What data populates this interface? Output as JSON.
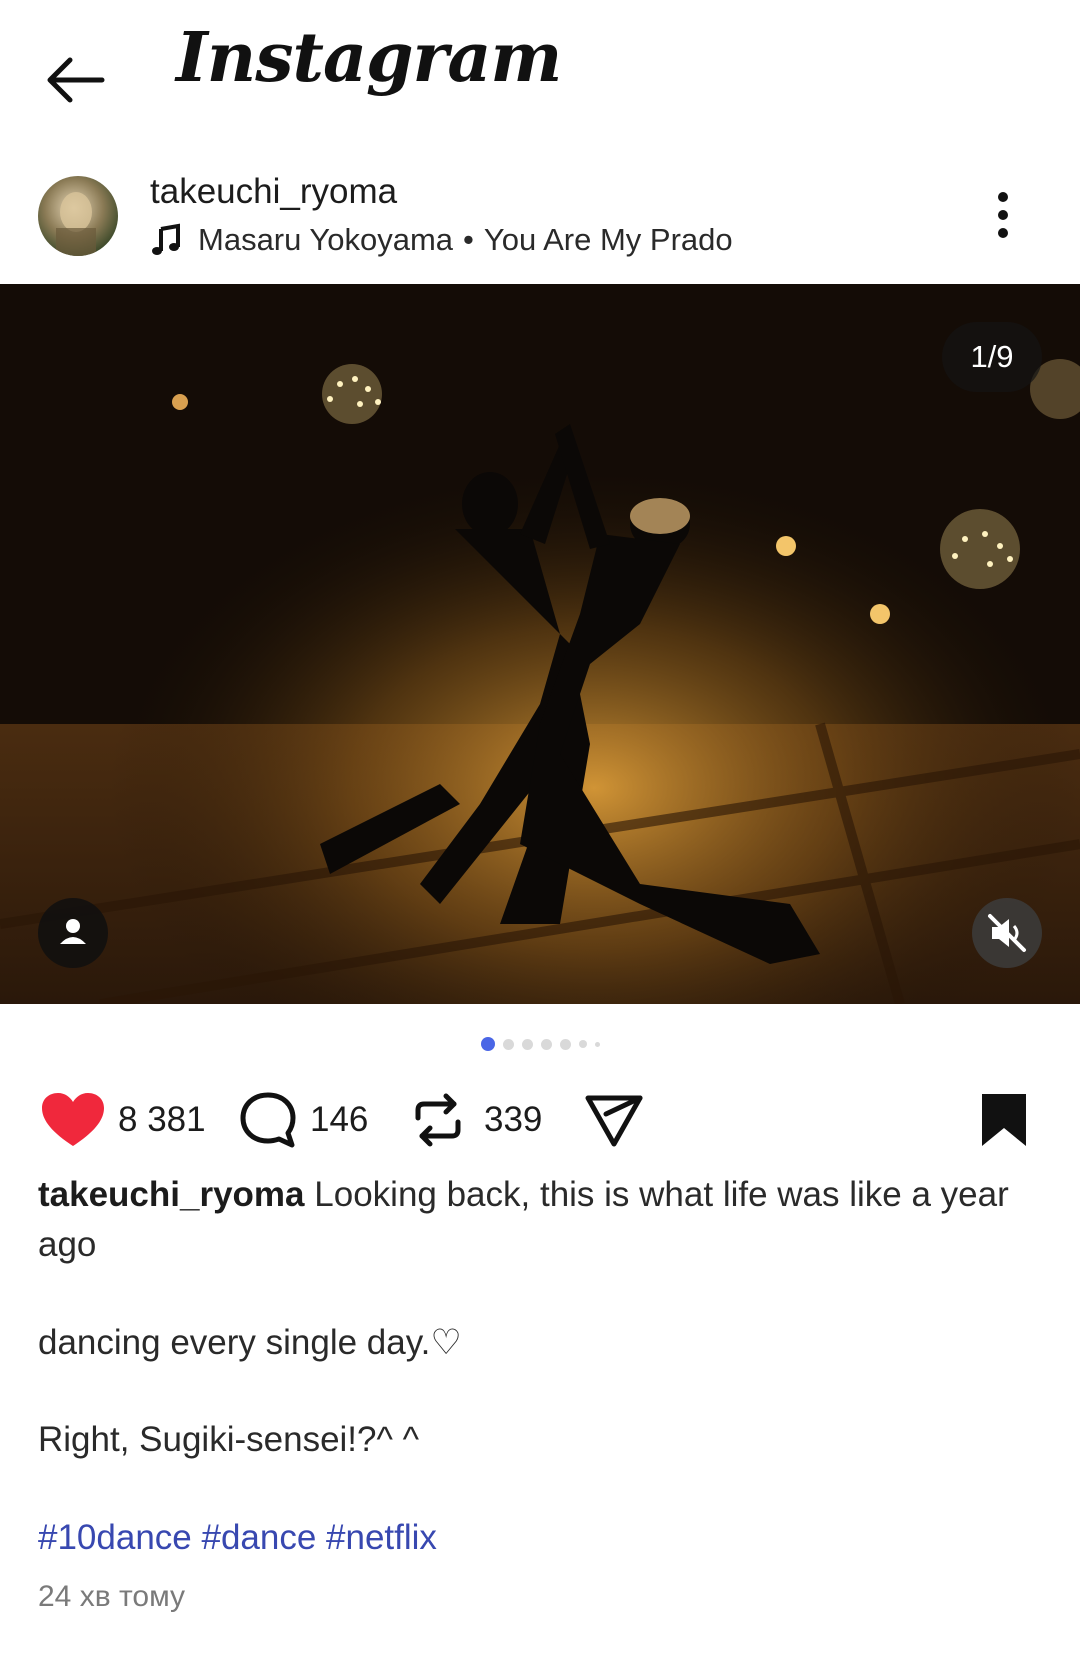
{
  "app": {
    "title": "Instagram"
  },
  "post": {
    "username": "takeuchi_ryoma",
    "music": {
      "artist": "Masaru Yokoyama",
      "separator": "•",
      "track": "You Are My Prado"
    },
    "media": {
      "counter": "1/9",
      "total": 9,
      "current": 1
    },
    "stats": {
      "likes": "8 381",
      "comments": "146",
      "reposts": "339"
    },
    "caption": {
      "username": "takeuchi_ryoma",
      "line1": "Looking back, this is what life was like a year ago",
      "line2": "dancing every single day.♡",
      "line3": "Right, Sugiki-sensei!?^ ^",
      "hashtags": "#10dance #dance #netflix"
    },
    "time": "24 хв тому"
  },
  "colors": {
    "like": "#f0283c",
    "hashtag": "#3848b0",
    "active_dot": "#4a66e6"
  },
  "icons": [
    "back-arrow-icon",
    "music-note-icon",
    "more-vertical-icon",
    "user-tag-icon",
    "mute-icon",
    "heart-icon",
    "comment-icon",
    "repost-icon",
    "share-icon",
    "bookmark-icon"
  ]
}
